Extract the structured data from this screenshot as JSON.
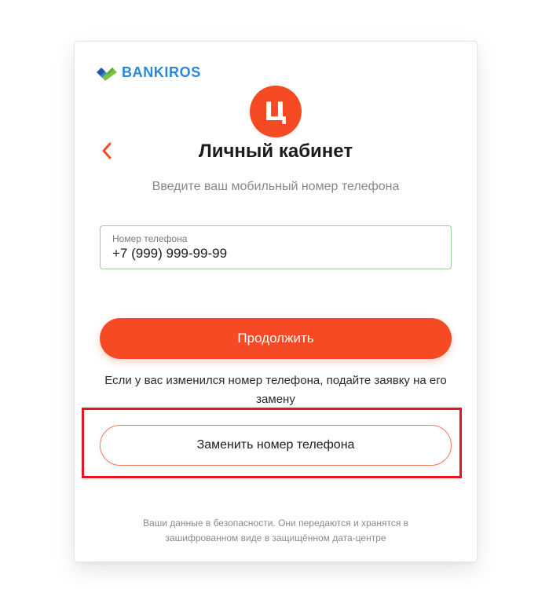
{
  "logo": {
    "text": "BANKIROS",
    "icon": "checkmark-logo-icon",
    "colors": {
      "green": "#7fc241",
      "blue": "#2a87d6",
      "dark": "#1e5aa8"
    }
  },
  "brand": {
    "letter": "Ц",
    "color": "#f54a23"
  },
  "header": {
    "back_icon": "chevron-left-icon",
    "title": "Личный кабинет"
  },
  "subtitle": "Введите ваш мобильный номер телефона",
  "phone": {
    "label": "Номер телефона",
    "value": "+7 (999) 999-99-99"
  },
  "continue_label": "Продолжить",
  "info_text": "Если у вас изменился номер телефона, подайте заявку на его замену",
  "replace_label": "Заменить номер телефона",
  "footer_text": "Ваши данные в безопасности. Они передаются и хранятся в зашифрованном виде в защищённом дата-центре",
  "colors": {
    "accent": "#f54a23",
    "input_border": "#9bd09a",
    "highlight": "#e8141e"
  }
}
